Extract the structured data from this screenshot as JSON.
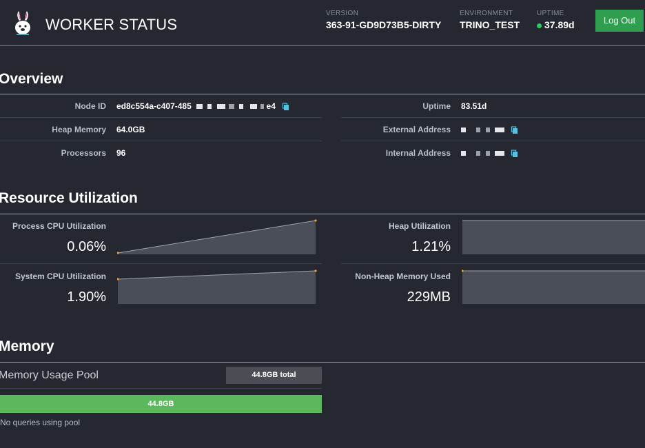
{
  "header": {
    "title": "WORKER STATUS",
    "version_label": "VERSION",
    "version_value": "363-91-GD9D73B5-DIRTY",
    "environment_label": "ENVIRONMENT",
    "environment_value": "TRINO_TEST",
    "uptime_label": "UPTIME",
    "uptime_value": "37.89d",
    "logout_label": "Log Out",
    "status_color": "#23d160",
    "logo_icon": "bunny-logo-icon"
  },
  "overview": {
    "title": "Overview",
    "left": [
      {
        "label": "Node ID",
        "value": "ed8c554a-c407-485",
        "suffix": "e4",
        "redacted": true,
        "copy": true
      },
      {
        "label": "Heap Memory",
        "value": "64.0GB"
      },
      {
        "label": "Processors",
        "value": "96"
      }
    ],
    "right": [
      {
        "label": "Uptime",
        "value": "83.51d"
      },
      {
        "label": "External Address",
        "value": "",
        "redacted": true,
        "copy": true
      },
      {
        "label": "Internal Address",
        "value": "",
        "redacted": true,
        "copy": true
      }
    ]
  },
  "resource": {
    "title": "Resource Utilization",
    "metrics": [
      {
        "label": "Process CPU Utilization",
        "value": "0.06%"
      },
      {
        "label": "Heap Utilization",
        "value": "1.21%"
      },
      {
        "label": "System CPU Utilization",
        "value": "1.90%"
      },
      {
        "label": "Non-Heap Memory Used",
        "value": "229MB"
      }
    ],
    "spark_fill_color": "#4a4e58",
    "spark_line_color": "#9ea4ae",
    "spark_point_color": "#f0a030"
  },
  "memory": {
    "title": "Memory",
    "pool_title": "Memory Usage Pool",
    "pool_total": "44.8GB total",
    "pool_bar_value": "44.8GB",
    "pool_fill": 1.0,
    "pool_bar_color": "#5cb85c",
    "no_queries": "No queries using pool"
  }
}
